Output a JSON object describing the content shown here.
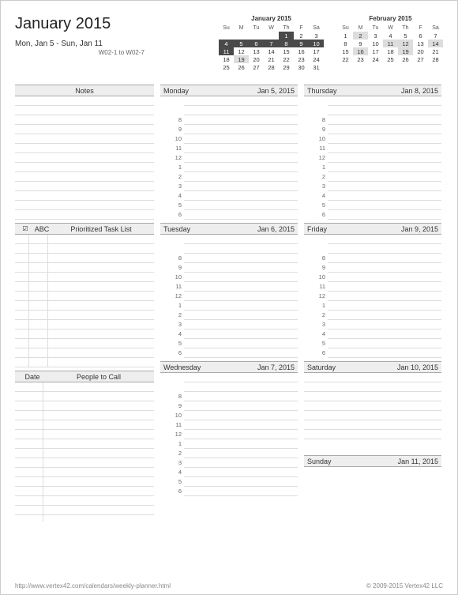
{
  "title": "January 2015",
  "range": "Mon, Jan 5  -  Sun, Jan 11",
  "weeks": "W02-1 to W02-7",
  "miniCal1": {
    "title": "January 2015",
    "dow": [
      "Su",
      "M",
      "Tu",
      "W",
      "Th",
      "F",
      "Sa"
    ],
    "rows": [
      [
        "",
        "",
        "",
        "",
        "1",
        "2",
        "3"
      ],
      [
        "4",
        "5",
        "6",
        "7",
        "8",
        "9",
        "10"
      ],
      [
        "11",
        "12",
        "13",
        "14",
        "15",
        "16",
        "17"
      ],
      [
        "18",
        "19",
        "20",
        "21",
        "22",
        "23",
        "24"
      ],
      [
        "25",
        "26",
        "27",
        "28",
        "29",
        "30",
        "31"
      ]
    ],
    "hl": [
      [
        0,
        4
      ],
      [
        1,
        0
      ],
      [
        1,
        1
      ],
      [
        1,
        2
      ],
      [
        1,
        3
      ],
      [
        1,
        4
      ],
      [
        1,
        5
      ],
      [
        1,
        6
      ],
      [
        2,
        0
      ]
    ],
    "hl2": [
      [
        3,
        1
      ]
    ]
  },
  "miniCal2": {
    "title": "February 2015",
    "dow": [
      "Su",
      "M",
      "Tu",
      "W",
      "Th",
      "F",
      "Sa"
    ],
    "rows": [
      [
        "1",
        "2",
        "3",
        "4",
        "5",
        "6",
        "7"
      ],
      [
        "8",
        "9",
        "10",
        "11",
        "12",
        "13",
        "14"
      ],
      [
        "15",
        "16",
        "17",
        "18",
        "19",
        "20",
        "21"
      ],
      [
        "22",
        "23",
        "24",
        "25",
        "26",
        "27",
        "28"
      ]
    ],
    "hl2": [
      [
        0,
        1
      ],
      [
        1,
        3
      ],
      [
        1,
        4
      ],
      [
        1,
        6
      ],
      [
        2,
        1
      ],
      [
        2,
        4
      ]
    ]
  },
  "sections": {
    "notes": "Notes",
    "tasks": {
      "check": "☑",
      "abc": "ABC",
      "label": "Prioritized Task List"
    },
    "people": {
      "date": "Date",
      "label": "People to Call"
    }
  },
  "days": [
    {
      "name": "Monday",
      "date": "Jan 5, 2015"
    },
    {
      "name": "Tuesday",
      "date": "Jan 6, 2015"
    },
    {
      "name": "Wednesday",
      "date": "Jan 7, 2015"
    },
    {
      "name": "Thursday",
      "date": "Jan 8, 2015"
    },
    {
      "name": "Friday",
      "date": "Jan 9, 2015"
    },
    {
      "name": "Saturday",
      "date": "Jan 10, 2015"
    },
    {
      "name": "Sunday",
      "date": "Jan 11, 2015"
    }
  ],
  "hours": [
    "8",
    "9",
    "10",
    "11",
    "12",
    "1",
    "2",
    "3",
    "4",
    "5",
    "6"
  ],
  "footer": {
    "url": "http://www.vertex42.com/calendars/weekly-planner.html",
    "copy": "© 2009-2015 Vertex42 LLC"
  }
}
